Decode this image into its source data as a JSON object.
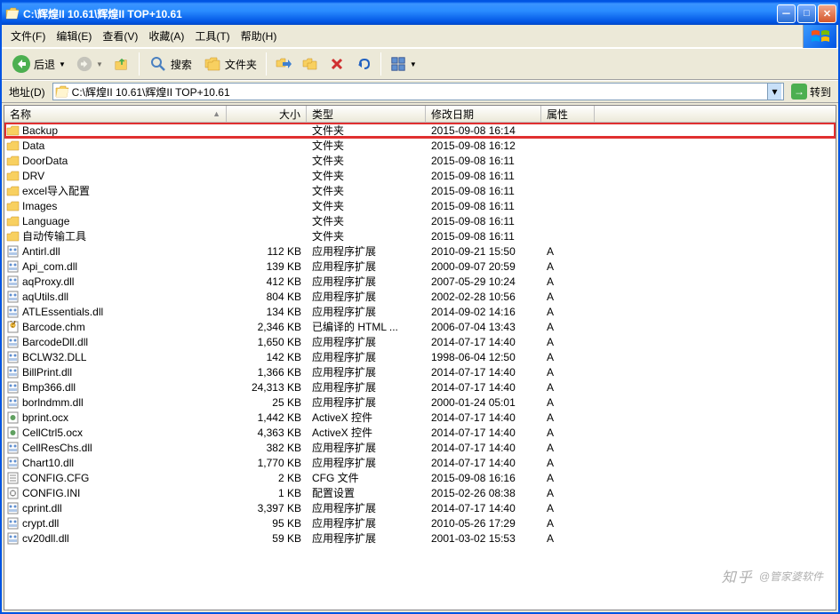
{
  "title": "C:\\辉煌II 10.61\\辉煌II TOP+10.61",
  "menus": [
    {
      "label": "文件(F)"
    },
    {
      "label": "编辑(E)"
    },
    {
      "label": "查看(V)"
    },
    {
      "label": "收藏(A)"
    },
    {
      "label": "工具(T)"
    },
    {
      "label": "帮助(H)"
    }
  ],
  "toolbar": {
    "back": "后退",
    "search": "搜索",
    "folders": "文件夹"
  },
  "addressbar": {
    "label": "地址(D)",
    "path": "C:\\辉煌II 10.61\\辉煌II TOP+10.61",
    "go": "转到"
  },
  "columns": {
    "name": "名称",
    "size": "大小",
    "type": "类型",
    "date": "修改日期",
    "attr": "属性"
  },
  "files": [
    {
      "icon": "folder",
      "name": "Backup",
      "size": "",
      "type": "文件夹",
      "date": "2015-09-08 16:14",
      "attr": "",
      "hl": true
    },
    {
      "icon": "folder",
      "name": "Data",
      "size": "",
      "type": "文件夹",
      "date": "2015-09-08 16:12",
      "attr": ""
    },
    {
      "icon": "folder",
      "name": "DoorData",
      "size": "",
      "type": "文件夹",
      "date": "2015-09-08 16:11",
      "attr": ""
    },
    {
      "icon": "folder",
      "name": "DRV",
      "size": "",
      "type": "文件夹",
      "date": "2015-09-08 16:11",
      "attr": ""
    },
    {
      "icon": "folder",
      "name": "excel导入配置",
      "size": "",
      "type": "文件夹",
      "date": "2015-09-08 16:11",
      "attr": ""
    },
    {
      "icon": "folder",
      "name": "Images",
      "size": "",
      "type": "文件夹",
      "date": "2015-09-08 16:11",
      "attr": ""
    },
    {
      "icon": "folder",
      "name": "Language",
      "size": "",
      "type": "文件夹",
      "date": "2015-09-08 16:11",
      "attr": ""
    },
    {
      "icon": "folder",
      "name": "自动传输工具",
      "size": "",
      "type": "文件夹",
      "date": "2015-09-08 16:11",
      "attr": ""
    },
    {
      "icon": "dll",
      "name": "Antirl.dll",
      "size": "112 KB",
      "type": "应用程序扩展",
      "date": "2010-09-21 15:50",
      "attr": "A"
    },
    {
      "icon": "dll",
      "name": "Api_com.dll",
      "size": "139 KB",
      "type": "应用程序扩展",
      "date": "2000-09-07 20:59",
      "attr": "A"
    },
    {
      "icon": "dll",
      "name": "aqProxy.dll",
      "size": "412 KB",
      "type": "应用程序扩展",
      "date": "2007-05-29 10:24",
      "attr": "A"
    },
    {
      "icon": "dll",
      "name": "aqUtils.dll",
      "size": "804 KB",
      "type": "应用程序扩展",
      "date": "2002-02-28 10:56",
      "attr": "A"
    },
    {
      "icon": "dll",
      "name": "ATLEssentials.dll",
      "size": "134 KB",
      "type": "应用程序扩展",
      "date": "2014-09-02 14:16",
      "attr": "A"
    },
    {
      "icon": "chm",
      "name": "Barcode.chm",
      "size": "2,346 KB",
      "type": "已编译的 HTML ...",
      "date": "2006-07-04 13:43",
      "attr": "A"
    },
    {
      "icon": "dll",
      "name": "BarcodeDll.dll",
      "size": "1,650 KB",
      "type": "应用程序扩展",
      "date": "2014-07-17 14:40",
      "attr": "A"
    },
    {
      "icon": "dll",
      "name": "BCLW32.DLL",
      "size": "142 KB",
      "type": "应用程序扩展",
      "date": "1998-06-04 12:50",
      "attr": "A"
    },
    {
      "icon": "dll",
      "name": "BillPrint.dll",
      "size": "1,366 KB",
      "type": "应用程序扩展",
      "date": "2014-07-17 14:40",
      "attr": "A"
    },
    {
      "icon": "dll",
      "name": "Bmp366.dll",
      "size": "24,313 KB",
      "type": "应用程序扩展",
      "date": "2014-07-17 14:40",
      "attr": "A"
    },
    {
      "icon": "dll",
      "name": "borlndmm.dll",
      "size": "25 KB",
      "type": "应用程序扩展",
      "date": "2000-01-24 05:01",
      "attr": "A"
    },
    {
      "icon": "ocx",
      "name": "bprint.ocx",
      "size": "1,442 KB",
      "type": "ActiveX 控件",
      "date": "2014-07-17 14:40",
      "attr": "A"
    },
    {
      "icon": "ocx",
      "name": "CellCtrl5.ocx",
      "size": "4,363 KB",
      "type": "ActiveX 控件",
      "date": "2014-07-17 14:40",
      "attr": "A"
    },
    {
      "icon": "dll",
      "name": "CellResChs.dll",
      "size": "382 KB",
      "type": "应用程序扩展",
      "date": "2014-07-17 14:40",
      "attr": "A"
    },
    {
      "icon": "dll",
      "name": "Chart10.dll",
      "size": "1,770 KB",
      "type": "应用程序扩展",
      "date": "2014-07-17 14:40",
      "attr": "A"
    },
    {
      "icon": "cfg",
      "name": "CONFIG.CFG",
      "size": "2 KB",
      "type": "CFG 文件",
      "date": "2015-09-08 16:16",
      "attr": "A"
    },
    {
      "icon": "ini",
      "name": "CONFIG.INI",
      "size": "1 KB",
      "type": "配置设置",
      "date": "2015-02-26 08:38",
      "attr": "A"
    },
    {
      "icon": "dll",
      "name": "cprint.dll",
      "size": "3,397 KB",
      "type": "应用程序扩展",
      "date": "2014-07-17 14:40",
      "attr": "A"
    },
    {
      "icon": "dll",
      "name": "crypt.dll",
      "size": "95 KB",
      "type": "应用程序扩展",
      "date": "2010-05-26 17:29",
      "attr": "A"
    },
    {
      "icon": "dll",
      "name": "cv20dll.dll",
      "size": "59 KB",
      "type": "应用程序扩展",
      "date": "2001-03-02 15:53",
      "attr": "A"
    }
  ],
  "watermark": {
    "brand": "知乎",
    "author": "@管家婆软件"
  }
}
